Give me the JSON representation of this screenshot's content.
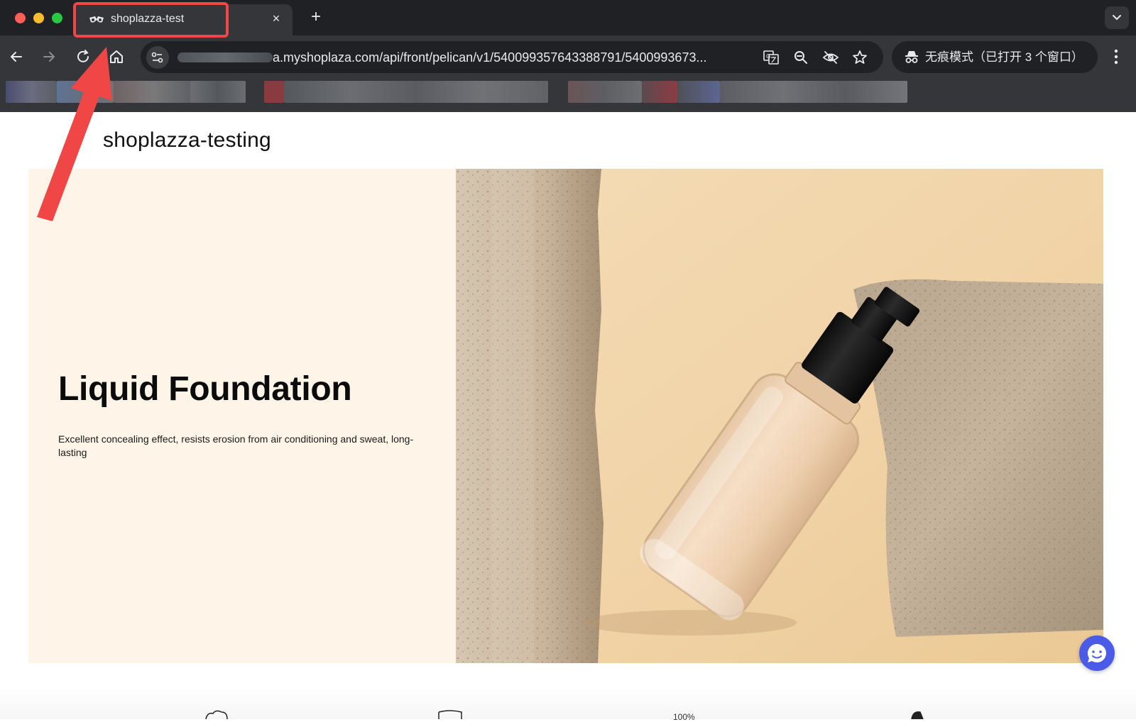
{
  "browser": {
    "tab": {
      "title": "shoplazza-test",
      "close_glyph": "×"
    },
    "new_tab_glyph": "+",
    "address_bar": {
      "url": "a.myshoplaza.com/api/front/pelican/v1/5400993576433887​91/5400993673..."
    },
    "incognito_label": "无痕模式（已打开 3 个窗口）",
    "icons": [
      "back-icon",
      "forward-icon",
      "reload-icon",
      "home-icon",
      "site-settings-icon",
      "translate-icon",
      "zoom-icon",
      "eye-off-icon",
      "star-icon",
      "incognito-icon",
      "kebab-menu-icon",
      "tab-search-icon"
    ]
  },
  "store": {
    "name": "shoplazza-testing"
  },
  "hero": {
    "title": "Liquid Foundation",
    "subtitle": "Excellent concealing effect, resists erosion from air conditioning and sweat, long-lasting",
    "background_color": "#fef5e8"
  },
  "features": {
    "partial_text": "100%"
  },
  "colors": {
    "annotation": "#f04646",
    "chat": "#4b5ae7",
    "chrome_dark": "#202124",
    "chrome_mid": "#35363a"
  }
}
